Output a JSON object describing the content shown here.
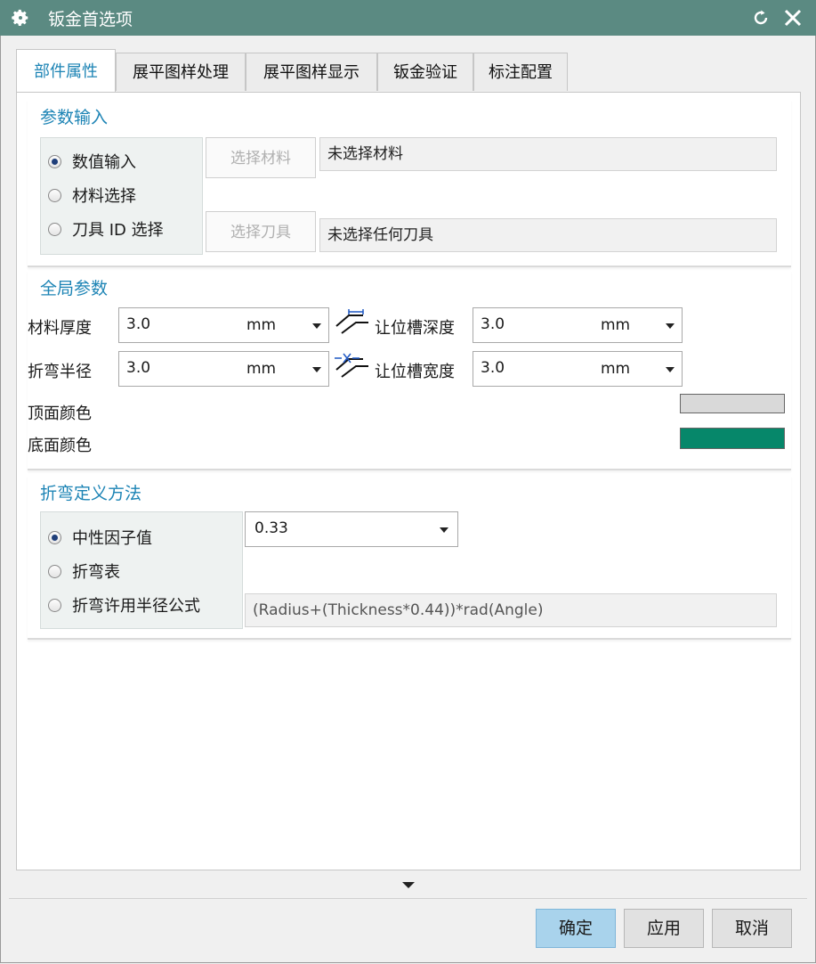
{
  "window": {
    "title": "钣金首选项"
  },
  "tabs": [
    {
      "label": "部件属性",
      "active": true
    },
    {
      "label": "展平图样处理"
    },
    {
      "label": "展平图样显示"
    },
    {
      "label": "钣金验证"
    },
    {
      "label": "标注配置"
    }
  ],
  "param_input": {
    "title": "参数输入",
    "options": [
      "数值输入",
      "材料选择",
      "刀具 ID 选择"
    ],
    "selected": "数值输入",
    "select_material_button": "选择材料",
    "material_value": "未选择材料",
    "select_tool_button": "选择刀具",
    "tool_value": "未选择任何刀具"
  },
  "global_params": {
    "title": "全局参数",
    "thickness": {
      "label": "材料厚度",
      "value": "3.0",
      "unit": "mm"
    },
    "bend_radius": {
      "label": "折弯半径",
      "value": "3.0",
      "unit": "mm"
    },
    "relief_depth": {
      "label": "让位槽深度",
      "value": "3.0",
      "unit": "mm"
    },
    "relief_width": {
      "label": "让位槽宽度",
      "value": "3.0",
      "unit": "mm"
    },
    "top_color": {
      "label": "顶面颜色",
      "color": "#d9d9d9"
    },
    "bottom_color": {
      "label": "底面颜色",
      "color": "#06876a"
    }
  },
  "bend_method": {
    "title": "折弯定义方法",
    "options": [
      "中性因子值",
      "折弯表",
      "折弯许用半径公式"
    ],
    "selected": "中性因子值",
    "neutral_factor": "0.33",
    "formula": "(Radius+(Thickness*0.44))*rad(Angle)"
  },
  "footer": {
    "ok": "确定",
    "apply": "应用",
    "cancel": "取消"
  },
  "colors": {
    "titlebar": "#5b8a82",
    "accent": "#1d84b5",
    "primary_button": "#a9d3ec"
  }
}
